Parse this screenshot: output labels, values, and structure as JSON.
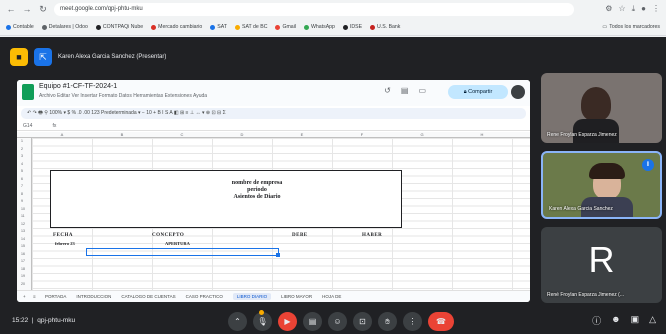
{
  "browser": {
    "url": "meet.google.com/qpj-phtu-mku",
    "bookmarks": [
      {
        "label": "Contable",
        "color": "#1a73e8"
      },
      {
        "label": "Detalares | Odoo",
        "color": "#5f6368"
      },
      {
        "label": "CONTPAQi Nube",
        "color": "#202124"
      },
      {
        "label": "Mercado cambiario",
        "color": "#d93025"
      },
      {
        "label": "SAT",
        "color": "#1a73e8"
      },
      {
        "label": "SAT de BC",
        "color": "#f9ab00"
      },
      {
        "label": "Gmail",
        "color": "#ea4335"
      },
      {
        "label": "WhatsApp",
        "color": "#34a853"
      },
      {
        "label": "IDSE",
        "color": "#202124"
      },
      {
        "label": "U.S. Bank",
        "color": "#c5221f"
      }
    ],
    "bookmarks_right": "Todos los marcadores"
  },
  "presenter": {
    "label": "Karen Alexa Garcia Sanchez (Presentar)"
  },
  "sheet": {
    "title": "Equipo #1-CF-TF-2024-1",
    "menu": "Archivo  Editar  Ver  Insertar  Formato  Datos  Herramientas  Extensiones  Ayuda",
    "share_label": "Compartir",
    "toolbar": "↶  ↷  🖶  ⚲  100%  ▾  $  %  .0  .00  123  Predeterminada  ▾  −  10  +  B  I  S  A  ◧  ⊞  ≡  ⊥  ↔  ▾  ⊕  ⊡  ⊟  Σ",
    "cell_ref": "G14",
    "fx": "fx",
    "col_letters": [
      "",
      "A",
      "B",
      "C",
      "D",
      "E",
      "F",
      "G",
      "H"
    ],
    "row_numbers": [
      "1",
      "2",
      "3",
      "4",
      "5",
      "6",
      "7",
      "8",
      "9",
      "10",
      "11",
      "12",
      "13",
      "14",
      "15",
      "16",
      "17",
      "18",
      "19",
      "20"
    ],
    "company_lines": [
      "nombre de empresa",
      "periodo",
      "Asientos de Diario"
    ],
    "headers": {
      "fecha": "FECHA",
      "concepto": "CONCEPTO",
      "debe": "DEBE",
      "haber": "HABER"
    },
    "row_values": {
      "date": "febrero 23",
      "concept": "APERTURA"
    },
    "tabs": [
      "PORTADA",
      "INTRODUCCION",
      "CATALOGO DE CUENTAS",
      "CASO PRACTICO",
      "LIBRO DIARIO",
      "LIBRO MAYOR",
      "HOJA DE"
    ],
    "active_tab": "LIBRO DIARIO"
  },
  "participants": [
    {
      "name": "Rene Froylan Esparza Jimenez"
    },
    {
      "name": "Karen Alexa Garcia Sanchez"
    },
    {
      "name": "René Froylan Esparza Jimenez (...",
      "initial": "R"
    }
  ],
  "meeting": {
    "time": "15:22",
    "code": "qpj-phtu-mku"
  }
}
